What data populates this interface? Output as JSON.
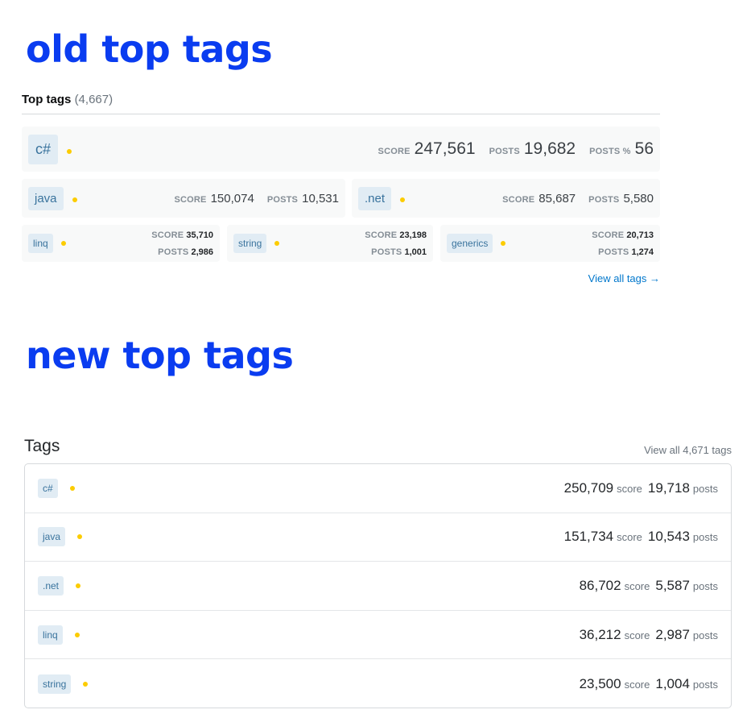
{
  "headings": {
    "old": "old top tags",
    "new": "new top tags"
  },
  "old": {
    "title": "Top tags",
    "count": "(4,667)",
    "featured": {
      "tag": "c#",
      "score_label": "Score",
      "score": "247,561",
      "posts_label": "Posts",
      "posts": "19,682",
      "posts_pct_label": "Posts %",
      "posts_pct": "56"
    },
    "second_row": [
      {
        "tag": "java",
        "score_label": "Score",
        "score": "150,074",
        "posts_label": "Posts",
        "posts": "10,531"
      },
      {
        "tag": ".net",
        "score_label": "Score",
        "score": "85,687",
        "posts_label": "Posts",
        "posts": "5,580"
      }
    ],
    "third_row": [
      {
        "tag": "linq",
        "score_label": "Score",
        "score": "35,710",
        "posts_label": "Posts",
        "posts": "2,986"
      },
      {
        "tag": "string",
        "score_label": "Score",
        "score": "23,198",
        "posts_label": "Posts",
        "posts": "1,001"
      },
      {
        "tag": "generics",
        "score_label": "Score",
        "score": "20,713",
        "posts_label": "Posts",
        "posts": "1,274"
      }
    ],
    "view_all": "View all tags →"
  },
  "new": {
    "title": "Tags",
    "view_all": "View all 4,671 tags",
    "score_unit": "score",
    "posts_unit": "posts",
    "rows": [
      {
        "tag": "c#",
        "score": "250,709",
        "posts": "19,718"
      },
      {
        "tag": "java",
        "score": "151,734",
        "posts": "10,543"
      },
      {
        "tag": ".net",
        "score": "86,702",
        "posts": "5,587"
      },
      {
        "tag": "linq",
        "score": "36,212",
        "posts": "2,987"
      },
      {
        "tag": "string",
        "score": "23,500",
        "posts": "1,004"
      }
    ]
  },
  "colors": {
    "heading": "#0a3cf0",
    "tag_bg": "#e1ecf4",
    "tag_text": "#39739d",
    "dot": "#fccc00",
    "link": "#0077cc"
  }
}
